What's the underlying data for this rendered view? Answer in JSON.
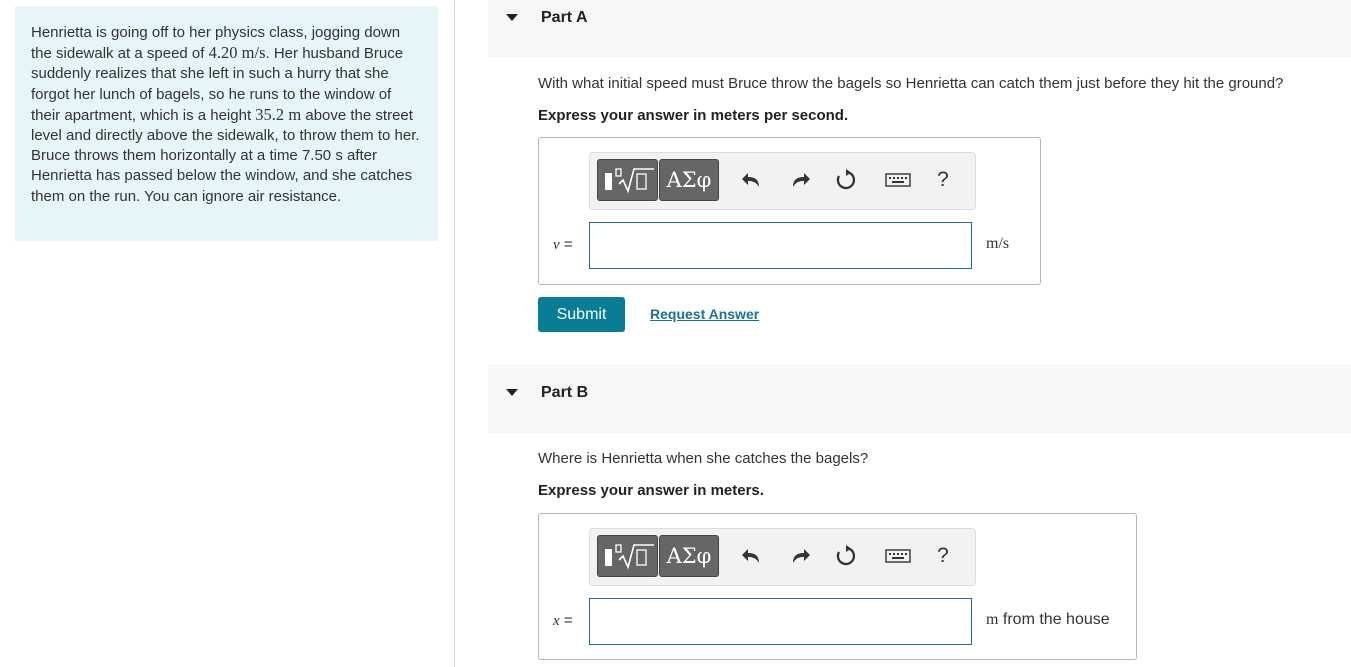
{
  "problem": {
    "text_1": "Henrietta is going off to her physics class, jogging down the sidewalk at a speed of ",
    "speed_value": "4.20",
    "speed_unit": "m/s",
    "text_2": ". Her husband Bruce suddenly realizes that she left in such a hurry that she forgot her lunch of bagels, so he runs to the window of their apartment, which is a height ",
    "height_value": "35.2",
    "height_unit": "m",
    "text_3": " above the street level and directly above the sidewalk, to throw them to her. Bruce throws them horizontally at a time ",
    "time_value": "7.50",
    "time_unit": "s",
    "text_4": " after Henrietta has passed below the window, and she catches them on the run. You can ignore air resistance."
  },
  "part_a": {
    "title": "Part A",
    "question": "With what initial speed must Bruce throw the bagels so Henrietta can catch them just before they hit the ground?",
    "instruction": "Express your answer in meters per second.",
    "variable": "v",
    "equals": "=",
    "unit": "m/s",
    "input_value": "",
    "submit_label": "Submit",
    "request_answer_label": "Request Answer"
  },
  "part_b": {
    "title": "Part B",
    "question": "Where is Henrietta when she catches the bagels?",
    "instruction": "Express your answer in meters.",
    "variable": "x",
    "equals": "=",
    "unit_math": "m",
    "unit_text": "from the house",
    "input_value": ""
  },
  "toolbar": {
    "greek_label": "ΑΣφ",
    "help_label": "?",
    "icons": [
      "templates-icon",
      "greek-letters-icon",
      "undo-icon",
      "redo-icon",
      "reset-icon",
      "keyboard-icon",
      "help-icon"
    ]
  },
  "colors": {
    "panel_bg": "#e6f6f8",
    "submit_bg": "#087d95",
    "link": "#1b6f99",
    "input_border": "#1d6f91"
  }
}
